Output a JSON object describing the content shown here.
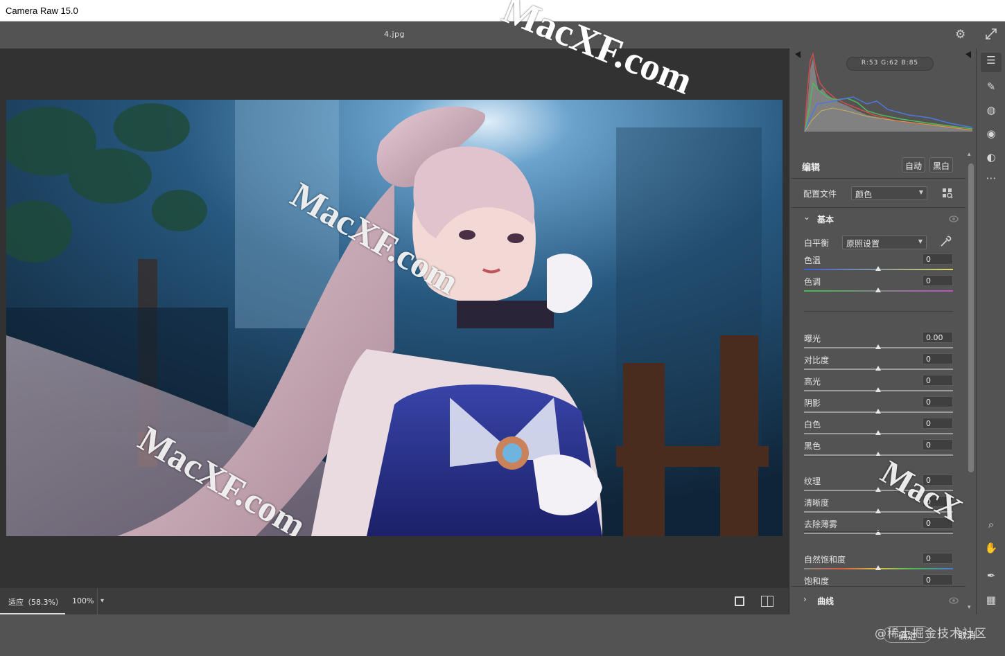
{
  "window": {
    "title": "Camera Raw 15.0"
  },
  "header": {
    "filename": "4.jpg"
  },
  "watermarks": [
    "MacXF.com",
    "MacXF.com",
    "MacXF.com",
    "MacXF.com",
    "MacX"
  ],
  "histogram": {
    "r_label": "R:53",
    "g_label": "G:62",
    "b_label": "B:85",
    "readout": "R:53 G:62 B:85"
  },
  "edit": {
    "title": "编辑",
    "auto_label": "自动",
    "bw_label": "黑白",
    "profile_label": "配置文件",
    "profile_value": "颜色",
    "basic_title": "基本",
    "wb_label": "白平衡",
    "wb_value": "原照设置",
    "sliders": [
      {
        "label": "色温",
        "value": "0"
      },
      {
        "label": "色调",
        "value": "0"
      },
      {
        "label": "曝光",
        "value": "0.00"
      },
      {
        "label": "对比度",
        "value": "0"
      },
      {
        "label": "高光",
        "value": "0"
      },
      {
        "label": "阴影",
        "value": "0"
      },
      {
        "label": "白色",
        "value": "0"
      },
      {
        "label": "黑色",
        "value": "0"
      },
      {
        "label": "纹理",
        "value": "0"
      },
      {
        "label": "清晰度",
        "value": "0"
      },
      {
        "label": "去除薄雾",
        "value": "0"
      },
      {
        "label": "自然饱和度",
        "value": "0"
      },
      {
        "label": "饱和度",
        "value": "0"
      }
    ],
    "curve_title": "曲线"
  },
  "bottom": {
    "zoom_fit": "适应（58.3%）",
    "zoom_100": "100%"
  },
  "footer": {
    "ok_label": "确定",
    "cancel_label": "取消",
    "juejin_watermark": "@稀土掘金技术社区"
  },
  "colors": {
    "panel": "#535353",
    "preview_bg": "#323232",
    "accent_blue": "#3d7cc9"
  }
}
